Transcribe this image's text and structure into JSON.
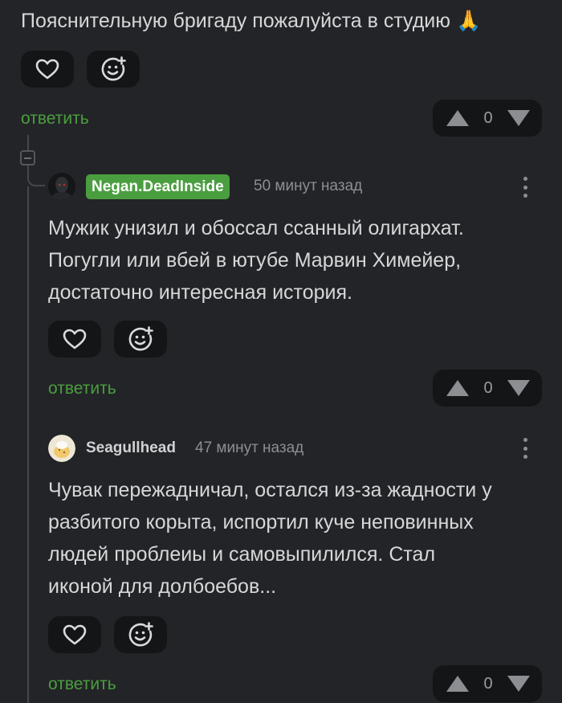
{
  "top_comment": {
    "text": "Пояснительную бригаду пожалуйста в студию 🙏",
    "reply_label": "ответить",
    "vote_count": "0"
  },
  "comment_1": {
    "username": "Negan.DeadInside",
    "timestamp": "50 минут назад",
    "text_lines": [
      "Мужик унизил и обоссал ссанный олигархат.",
      "Погугли или вбей в ютубе Марвин Химейер,",
      "достаточно интересная история."
    ],
    "reply_label": "ответить",
    "vote_count": "0"
  },
  "comment_2": {
    "username": "Seagullhead",
    "timestamp": "47 минут назад",
    "text_lines": [
      "Чувак пережадничал, остался из-за жадности у",
      "разбитого корыта, испортил куче неповинных",
      "людей проблеиы и самовыпилился. Стал",
      "иконой для долбоебов..."
    ],
    "reply_label": "ответить",
    "vote_count": "0"
  },
  "icons": {
    "heart": "heart-icon",
    "reaction": "add-reaction-icon",
    "upvote": "triangle-up-icon",
    "downvote": "triangle-down-icon",
    "menu": "kebab-menu-icon",
    "collapse": "collapse-minus-icon"
  },
  "colors": {
    "background": "#232427",
    "accent_green": "#4a9e3f",
    "pill_background": "#141517"
  }
}
